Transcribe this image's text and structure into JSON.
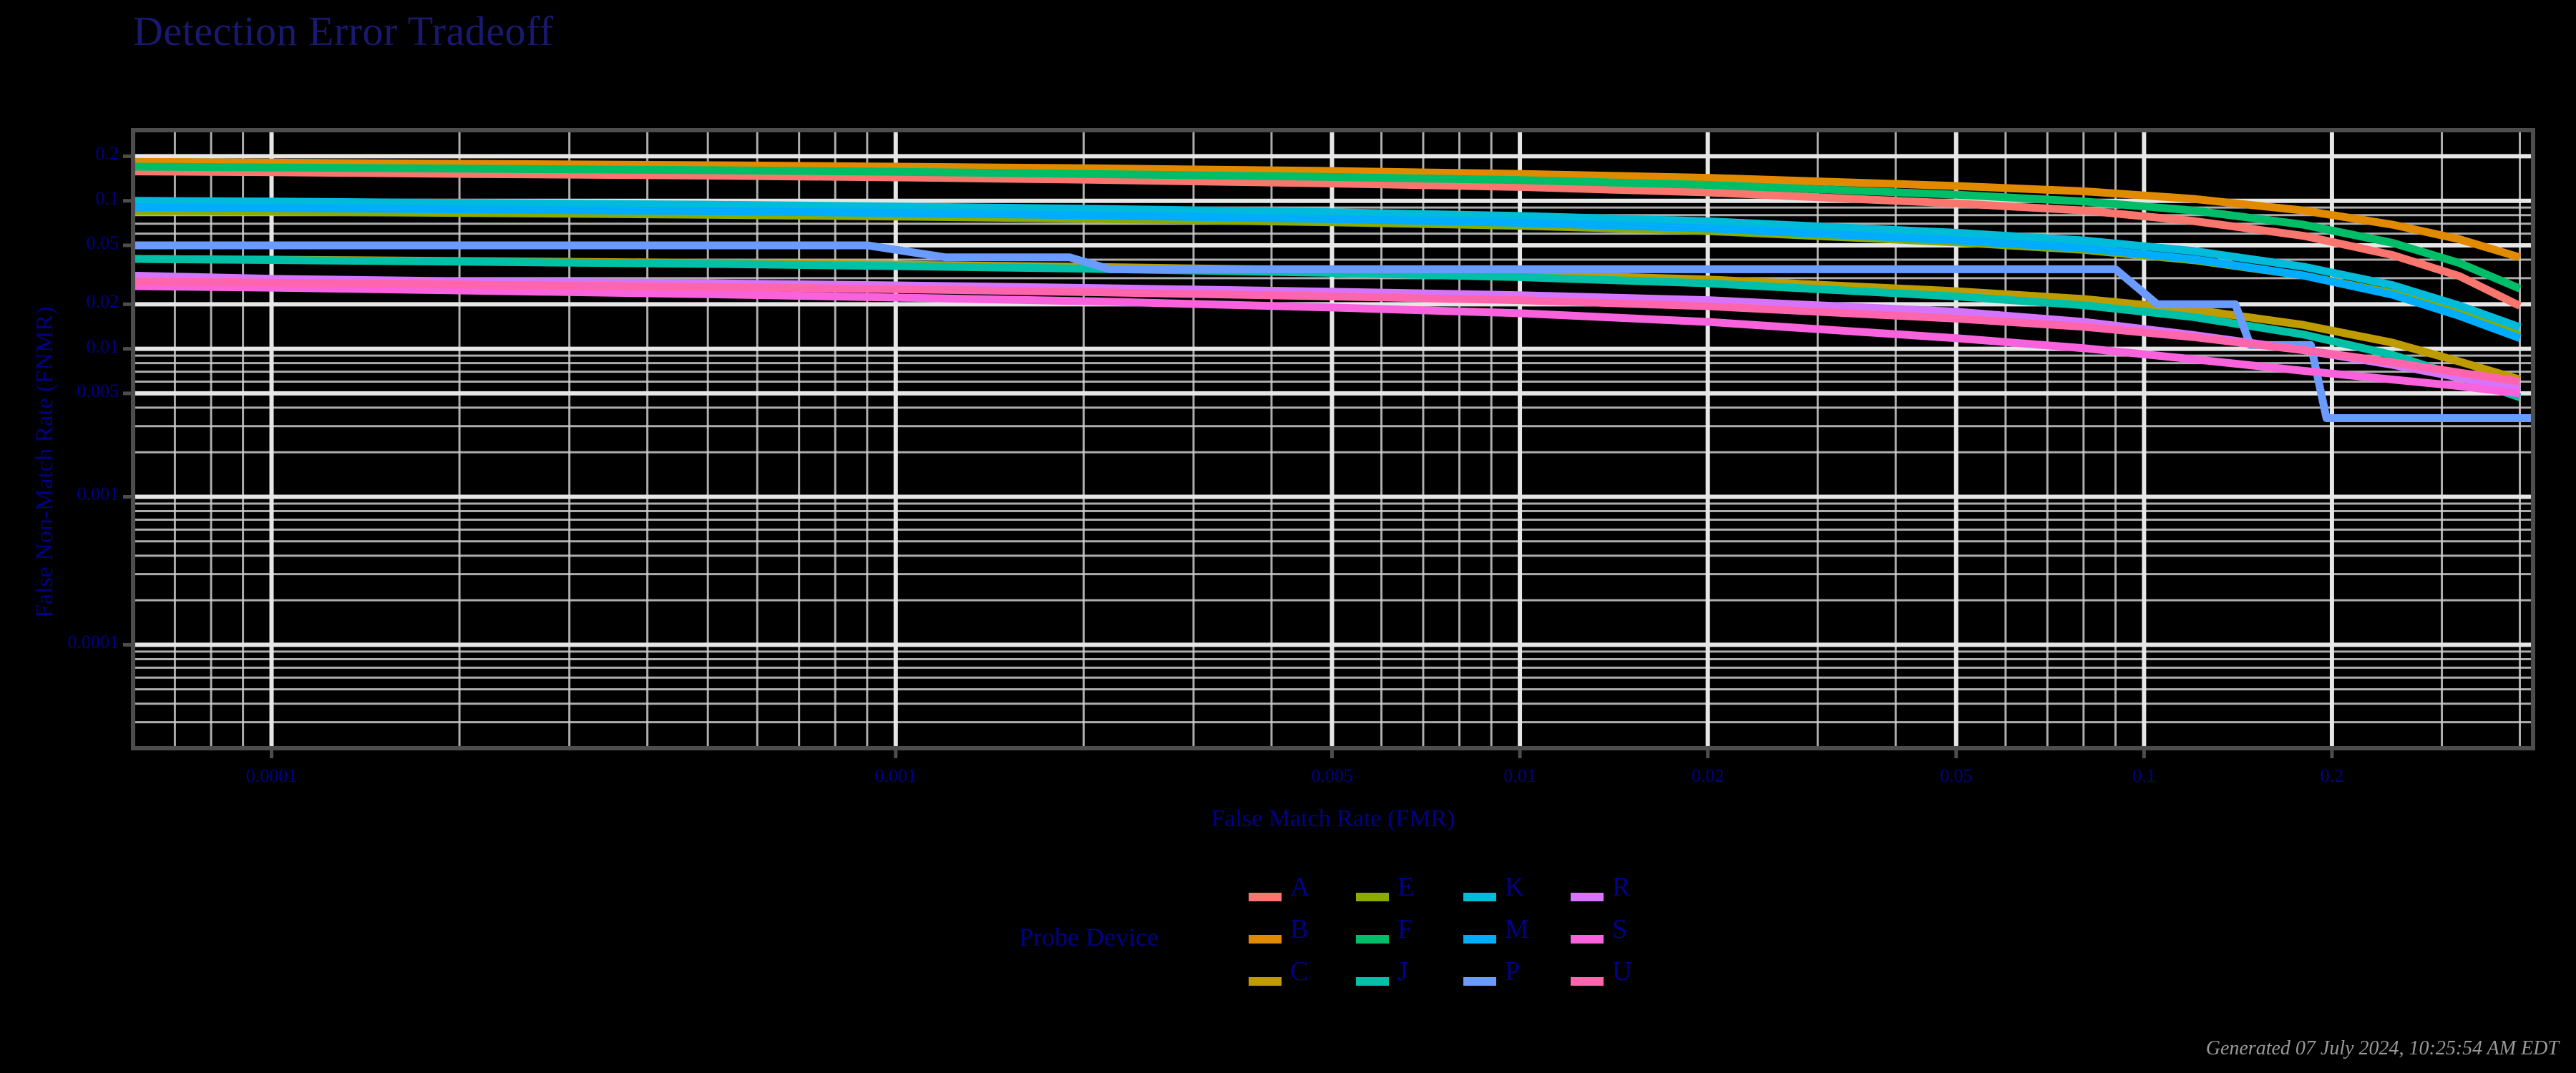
{
  "title": "Detection Error Tradeoff",
  "generated": "Generated 07 July 2024, 10:25:54 AM EDT",
  "legend": {
    "title": "Probe Device",
    "columns": [
      [
        "A",
        "B",
        "C"
      ],
      [
        "E",
        "F",
        "J"
      ],
      [
        "K",
        "M",
        "P"
      ],
      [
        "R",
        "S",
        "U"
      ]
    ]
  },
  "theme": {
    "background": "#000000",
    "text": "#00008B",
    "title_text": "#191970",
    "grid_major": "#E6E6E6",
    "grid_minor": "#CCCCCC",
    "panel_border": "#4D4D4D",
    "footer_text": "#999999"
  },
  "chart_data": {
    "type": "line",
    "title": "Detection Error Tradeoff",
    "xlabel": "False Match Rate (FMR)",
    "ylabel": "False Non-Match Rate (FNMR)",
    "xscale": "log",
    "yscale": "log",
    "xlim": [
      6e-05,
      0.42
    ],
    "ylim": [
      2e-05,
      0.3
    ],
    "xticks": [
      0.0001,
      0.001,
      0.005,
      0.01,
      0.02,
      0.05,
      0.1,
      0.2
    ],
    "xticklabels": [
      "0.0001",
      "0.001",
      "0.005",
      "0.01",
      "0.02",
      "0.05",
      "0.1",
      "0.2"
    ],
    "yticks": [
      0.2,
      0.1,
      0.05,
      0.02,
      0.01,
      0.005,
      0.001,
      0.0001
    ],
    "yticklabels": [
      "0.2",
      "0.1",
      "0.05",
      "0.02",
      "0.01",
      "0.005",
      "0.001",
      "0.0001"
    ],
    "grid": true,
    "legend_position": "bottom",
    "legend_title": "Probe Device",
    "colors": {
      "A": "#F8766D",
      "B": "#E18A00",
      "C": "#BE9C00",
      "E": "#8CAB00",
      "F": "#00BE67",
      "J": "#00C1A7",
      "K": "#00BBDA",
      "M": "#00ACFC",
      "P": "#6A9BFF",
      "R": "#D575FE",
      "S": "#F962DD",
      "U": "#FF65AC"
    },
    "series": [
      {
        "name": "A",
        "color": "#F8766D",
        "x": [
          6e-05,
          0.0001,
          0.0002,
          0.0005,
          0.001,
          0.002,
          0.005,
          0.01,
          0.02,
          0.05,
          0.08,
          0.12,
          0.18,
          0.25,
          0.32,
          0.4
        ],
        "y": [
          0.158,
          0.156,
          0.152,
          0.148,
          0.144,
          0.139,
          0.131,
          0.124,
          0.114,
          0.096,
          0.086,
          0.073,
          0.058,
          0.043,
          0.031,
          0.0195
        ]
      },
      {
        "name": "B",
        "color": "#E18A00",
        "x": [
          6e-05,
          0.0001,
          0.0002,
          0.0005,
          0.001,
          0.002,
          0.005,
          0.01,
          0.02,
          0.05,
          0.08,
          0.12,
          0.18,
          0.25,
          0.32,
          0.4
        ],
        "y": [
          0.183,
          0.181,
          0.178,
          0.174,
          0.17,
          0.166,
          0.159,
          0.152,
          0.143,
          0.126,
          0.116,
          0.103,
          0.086,
          0.069,
          0.055,
          0.0415
        ]
      },
      {
        "name": "C",
        "color": "#BE9C00",
        "x": [
          6e-05,
          0.0001,
          0.0002,
          0.0005,
          0.001,
          0.002,
          0.005,
          0.01,
          0.02,
          0.05,
          0.08,
          0.12,
          0.18,
          0.25,
          0.32,
          0.4
        ],
        "y": [
          0.0405,
          0.04,
          0.0392,
          0.0381,
          0.037,
          0.0358,
          0.0339,
          0.032,
          0.0294,
          0.0245,
          0.0217,
          0.0184,
          0.0145,
          0.011,
          0.0082,
          0.0062
        ]
      },
      {
        "name": "E",
        "color": "#8CAB00",
        "x": [
          6e-05,
          0.0001,
          0.0002,
          0.0005,
          0.001,
          0.002,
          0.005,
          0.01,
          0.02,
          0.05,
          0.08,
          0.12,
          0.18,
          0.25,
          0.32,
          0.4
        ],
        "y": [
          0.0855,
          0.0845,
          0.0828,
          0.0805,
          0.0783,
          0.0757,
          0.0716,
          0.0678,
          0.0625,
          0.0524,
          0.0466,
          0.0397,
          0.0313,
          0.0237,
          0.0175,
          0.0124
        ]
      },
      {
        "name": "F",
        "color": "#00BE67",
        "x": [
          6e-05,
          0.0001,
          0.0002,
          0.0005,
          0.001,
          0.002,
          0.005,
          0.01,
          0.02,
          0.05,
          0.08,
          0.12,
          0.18,
          0.25,
          0.32,
          0.4
        ],
        "y": [
          0.17,
          0.168,
          0.165,
          0.161,
          0.157,
          0.152,
          0.145,
          0.138,
          0.128,
          0.11,
          0.099,
          0.086,
          0.069,
          0.052,
          0.038,
          0.0255
        ]
      },
      {
        "name": "J",
        "color": "#00C1A7",
        "x": [
          6e-05,
          0.0001,
          0.0002,
          0.0005,
          0.001,
          0.002,
          0.005,
          0.01,
          0.02,
          0.05,
          0.08,
          0.12,
          0.18,
          0.25,
          0.32,
          0.4
        ],
        "y": [
          0.0405,
          0.0398,
          0.0388,
          0.0375,
          0.0362,
          0.0348,
          0.0326,
          0.0305,
          0.0277,
          0.0226,
          0.0197,
          0.0164,
          0.0125,
          0.0091,
          0.0065,
          0.0047
        ]
      },
      {
        "name": "K",
        "color": "#00BBDA",
        "x": [
          6e-05,
          0.0001,
          0.0002,
          0.0005,
          0.001,
          0.002,
          0.005,
          0.01,
          0.02,
          0.05,
          0.08,
          0.12,
          0.18,
          0.25,
          0.32,
          0.4
        ],
        "y": [
          0.1,
          0.0988,
          0.0968,
          0.0941,
          0.0915,
          0.0884,
          0.0836,
          0.079,
          0.0727,
          0.0608,
          0.054,
          0.0458,
          0.0359,
          0.0269,
          0.0196,
          0.014
        ]
      },
      {
        "name": "M",
        "color": "#00ACFC",
        "x": [
          6e-05,
          0.0001,
          0.0002,
          0.0005,
          0.001,
          0.002,
          0.005,
          0.01,
          0.02,
          0.05,
          0.08,
          0.12,
          0.18,
          0.25,
          0.32,
          0.4
        ],
        "y": [
          0.0905,
          0.0894,
          0.0876,
          0.0851,
          0.0827,
          0.0798,
          0.0753,
          0.071,
          0.0651,
          0.054,
          0.0478,
          0.0403,
          0.0313,
          0.0232,
          0.0167,
          0.0118
        ]
      },
      {
        "name": "P",
        "color": "#6A9BFF",
        "x": [
          6e-05,
          0.0003,
          0.0005,
          0.0009,
          0.0012,
          0.0019,
          0.0022,
          0.006,
          0.02,
          0.04,
          0.09,
          0.105,
          0.14,
          0.148,
          0.185,
          0.196,
          0.42
        ],
        "y": [
          0.05,
          0.05,
          0.05,
          0.05,
          0.0415,
          0.0415,
          0.0345,
          0.0345,
          0.0345,
          0.0345,
          0.0345,
          0.02,
          0.02,
          0.0106,
          0.0106,
          0.0034,
          0.0034
        ]
      },
      {
        "name": "R",
        "color": "#D575FE",
        "x": [
          6e-05,
          0.0001,
          0.0002,
          0.0005,
          0.001,
          0.002,
          0.005,
          0.01,
          0.02,
          0.05,
          0.08,
          0.12,
          0.18,
          0.25,
          0.32,
          0.4
        ],
        "y": [
          0.0312,
          0.0297,
          0.0286,
          0.0277,
          0.0268,
          0.0258,
          0.0243,
          0.023,
          0.0213,
          0.0178,
          0.0152,
          0.0124,
          0.0098,
          0.0078,
          0.0064,
          0.0054
        ]
      },
      {
        "name": "S",
        "color": "#F962DD",
        "x": [
          6e-05,
          0.0001,
          0.0002,
          0.0005,
          0.001,
          0.002,
          0.005,
          0.01,
          0.02,
          0.05,
          0.08,
          0.12,
          0.18,
          0.25,
          0.32,
          0.4
        ],
        "y": [
          0.0265,
          0.0259,
          0.0248,
          0.0234,
          0.0222,
          0.021,
          0.019,
          0.0174,
          0.0152,
          0.0118,
          0.0101,
          0.0085,
          0.0071,
          0.0062,
          0.0056,
          0.005
        ]
      },
      {
        "name": "U",
        "color": "#FF65AC",
        "x": [
          6e-05,
          0.0001,
          0.0002,
          0.0005,
          0.001,
          0.002,
          0.005,
          0.01,
          0.02,
          0.05,
          0.08,
          0.12,
          0.18,
          0.25,
          0.32,
          0.4
        ],
        "y": [
          0.0285,
          0.028,
          0.0272,
          0.0262,
          0.0253,
          0.0242,
          0.0226,
          0.0213,
          0.0194,
          0.016,
          0.0141,
          0.012,
          0.0098,
          0.0081,
          0.0069,
          0.006
        ]
      }
    ]
  }
}
